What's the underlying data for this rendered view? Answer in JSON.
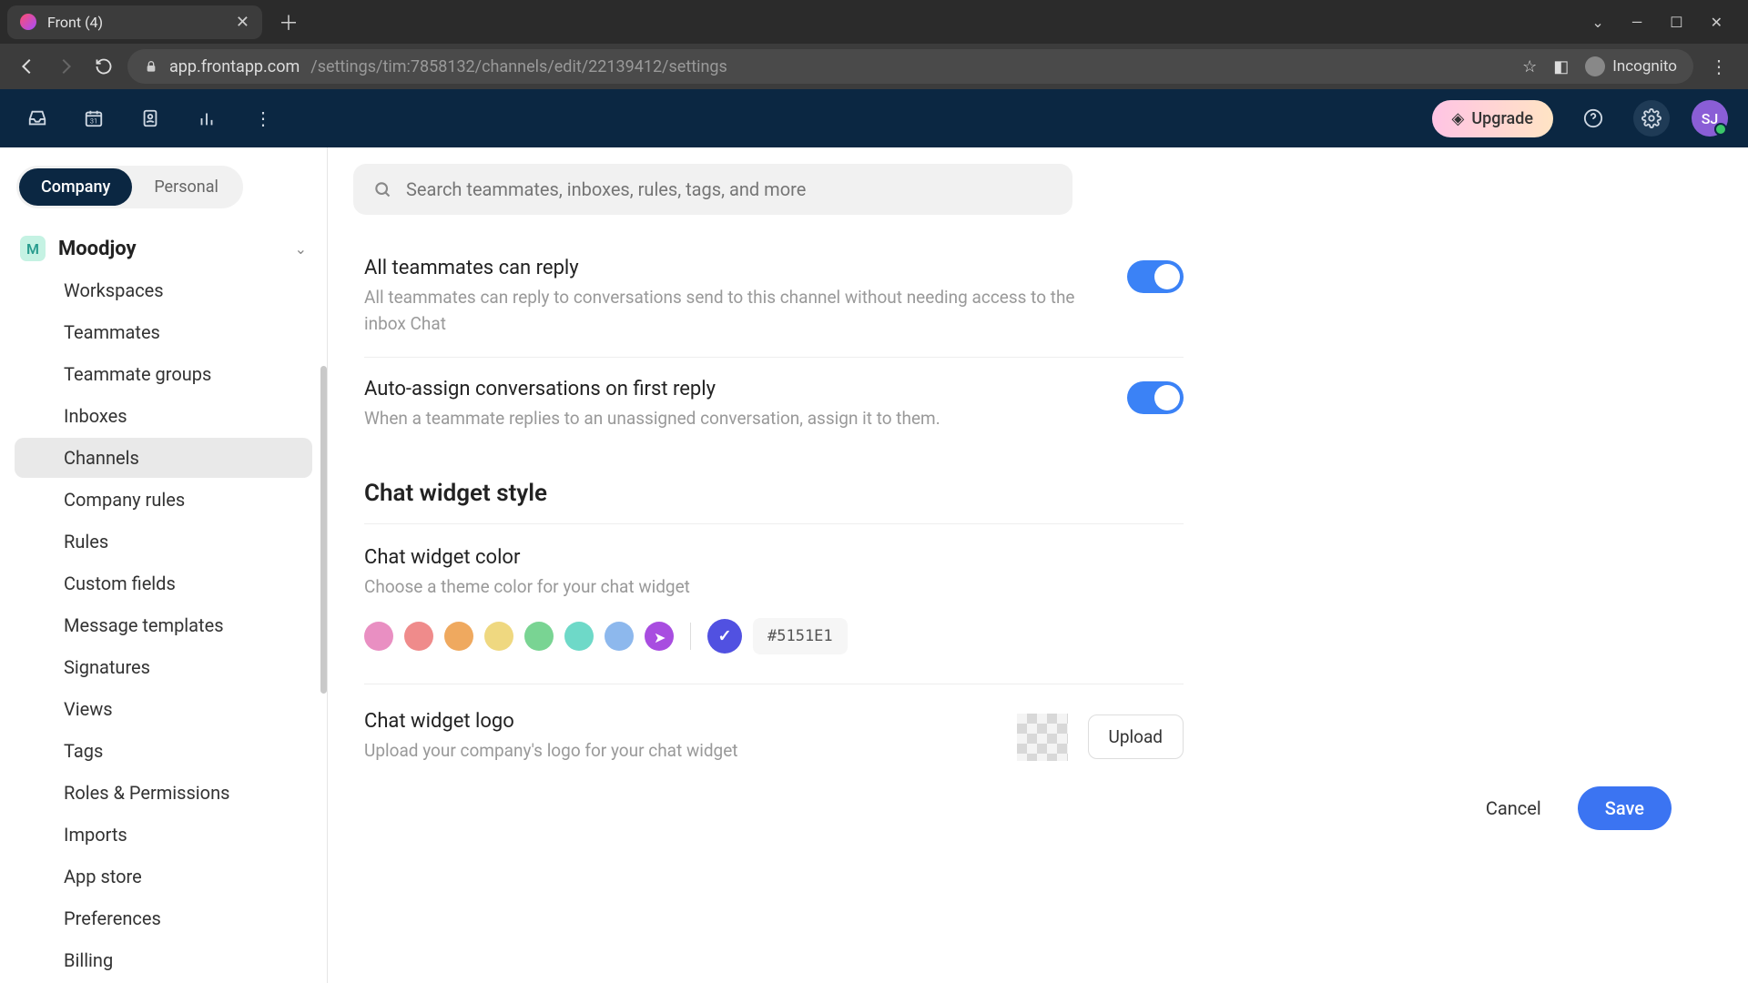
{
  "browser": {
    "tab_title": "Front (4)",
    "url_host": "app.frontapp.com",
    "url_path": "/settings/tim:7858132/channels/edit/22139412/settings",
    "incognito_label": "Incognito"
  },
  "header": {
    "upgrade_label": "Upgrade",
    "avatar_initials": "SJ"
  },
  "sidebar": {
    "seg_company": "Company",
    "seg_personal": "Personal",
    "workspace_initial": "M",
    "workspace_name": "Moodjoy",
    "items": [
      "Workspaces",
      "Teammates",
      "Teammate groups",
      "Inboxes",
      "Channels",
      "Company rules",
      "Rules",
      "Custom fields",
      "Message templates",
      "Signatures",
      "Views",
      "Tags",
      "Roles & Permissions",
      "Imports",
      "App store",
      "Preferences",
      "Billing"
    ],
    "active_index": 4
  },
  "search": {
    "placeholder": "Search teammates, inboxes, rules, tags, and more"
  },
  "settings": {
    "all_reply_title": "All teammates can reply",
    "all_reply_desc": "All teammates can reply to conversations send to this channel without needing access to the inbox Chat",
    "all_reply_on": true,
    "auto_assign_title": "Auto-assign conversations on first reply",
    "auto_assign_desc": "When a teammate replies to an unassigned conversation, assign it to them.",
    "auto_assign_on": true,
    "style_header": "Chat widget style",
    "color_title": "Chat widget color",
    "color_desc": "Choose a theme color for your chat widget",
    "colors": [
      "#e98fc2",
      "#ef8b8b",
      "#efa95f",
      "#efd880",
      "#79d493",
      "#6ed9c8",
      "#8db8ed",
      "#a84de0"
    ],
    "selected_color": "#5151E1",
    "hex_display": "#5151E1",
    "logo_title": "Chat widget logo",
    "logo_desc": "Upload your company's logo for your chat widget",
    "upload_label": "Upload"
  },
  "footer": {
    "cancel": "Cancel",
    "save": "Save"
  }
}
